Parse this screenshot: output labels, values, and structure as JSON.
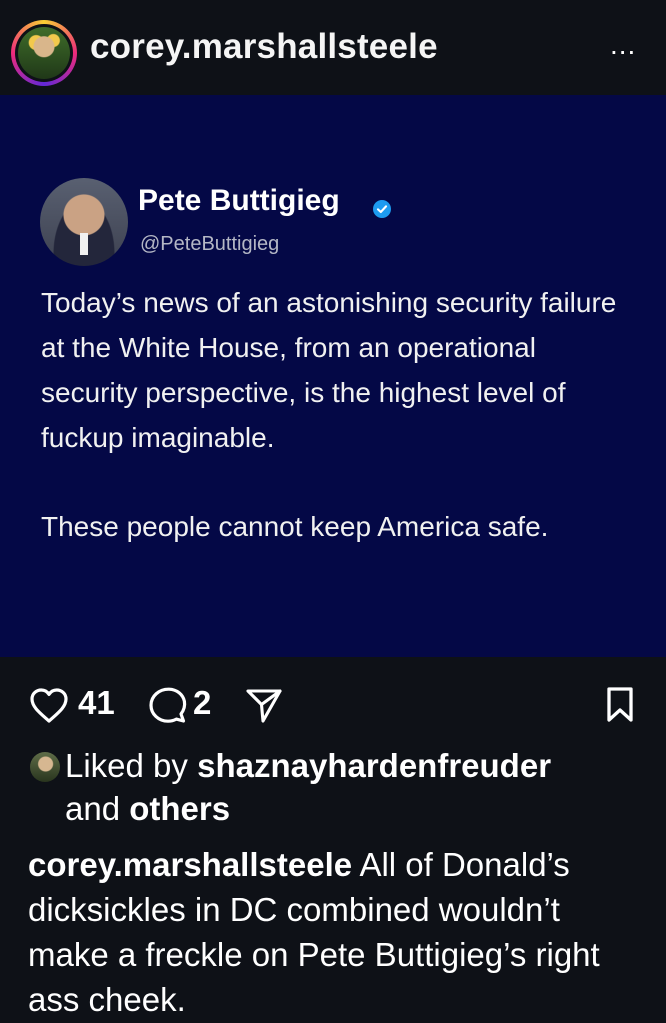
{
  "header": {
    "username": "corey.marshallsteele",
    "more_label": "..."
  },
  "post": {
    "author_name": "Pete Buttigieg",
    "author_handle": "@PeteButtigieg",
    "paragraphs": [
      "Today’s news of an astonishing security failure at the White House, from an operational security perspective, is the highest level of fuckup imaginable.",
      "These people cannot keep America safe."
    ]
  },
  "actions": {
    "likes_count": "41",
    "comments_count": "2"
  },
  "liked_by": {
    "prefix": "Liked by ",
    "username": "shaznayhardenfreuder",
    "middle": "and ",
    "suffix": "others"
  },
  "caption": {
    "username": "corey.marshallsteele",
    "text": " All of Donald’s dicksickles in DC combined wouldn’t make a freckle on Pete Buttigieg’s right ass cheek."
  },
  "icons": {
    "heart": "heart-icon",
    "comment": "comment-icon",
    "share": "send-icon",
    "save": "bookmark-icon",
    "verified": "verified-badge-icon"
  },
  "colors": {
    "app_background": "#0e1117",
    "post_background": "#040846",
    "verified_blue": "#1d9bf0"
  }
}
